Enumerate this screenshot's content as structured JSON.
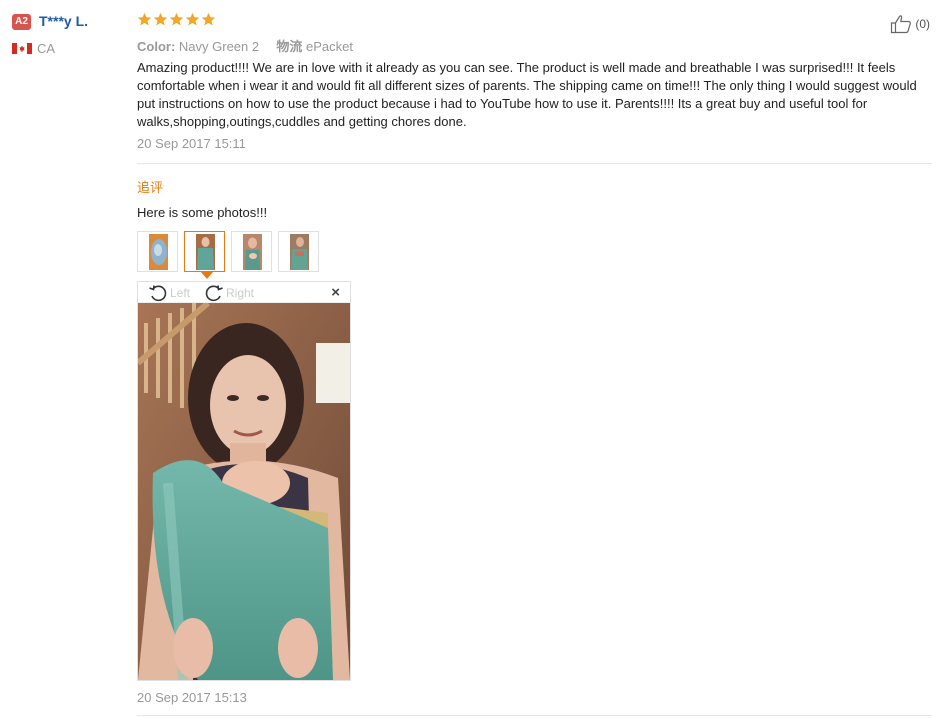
{
  "reviewer": {
    "level_badge": "A2",
    "name": "T***y L.",
    "country": "CA"
  },
  "review": {
    "rating": 5,
    "color_label": "Color:",
    "color_value": "Navy Green 2",
    "shipping_label": "物流",
    "shipping_value": "ePacket",
    "text": "Amazing product!!!! We are in love with it already as you can see. The product is well made and breathable I was surprised!!! It feels comfortable when i wear it and would fit all different sizes of parents. The shipping came on time!!! The only thing I would suggest would put instructions on how to use the product because i had to YouTube how to use it. Parents!!!! Its a great buy and useful tool for walks,shopping,outings,cuddles and getting chores done.",
    "date": "20 Sep 2017 15:11",
    "helpful_count": "(0)"
  },
  "additional_feedback": {
    "heading": "追评",
    "text": "Here is some photos!!!",
    "date": "20 Sep 2017 15:13",
    "selected_photo_index": 1,
    "photo_count": 4
  },
  "viewer": {
    "rotate_left_label": "Left",
    "rotate_right_label": "Right",
    "close_symbol": "×"
  },
  "colors": {
    "accent": "#e57b0f",
    "star": "#f5a623",
    "link": "#1f5ba8",
    "badge": "#d9534f"
  }
}
